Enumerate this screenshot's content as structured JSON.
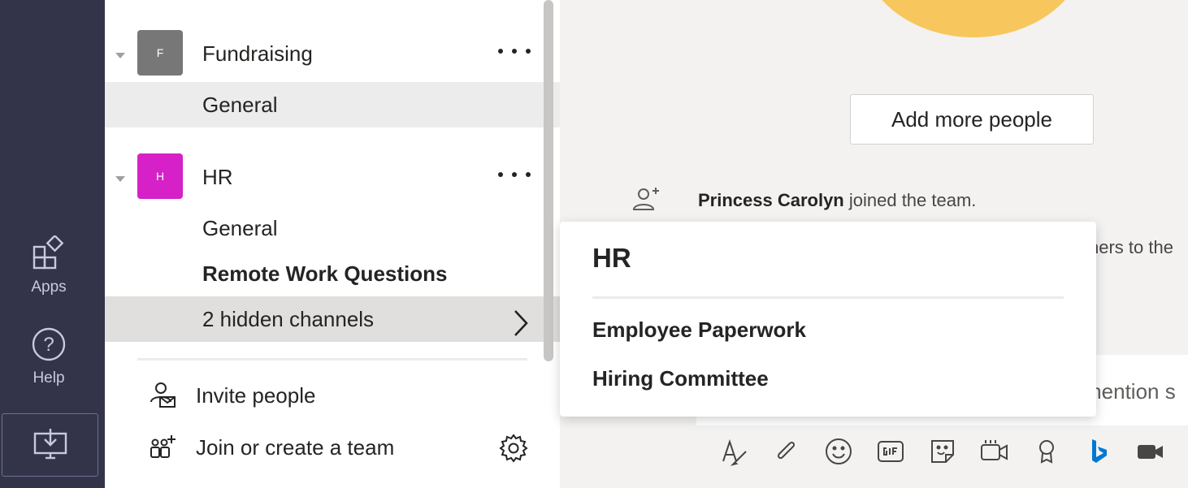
{
  "rail": {
    "apps_label": "Apps",
    "help_label": "Help",
    "help_symbol": "?"
  },
  "teams": [
    {
      "initial": "F",
      "name": "Fundraising",
      "color": "#777777",
      "channels": [
        "General"
      ]
    },
    {
      "initial": "H",
      "name": "HR",
      "color": "#d621c8",
      "channels": [
        "General",
        "Remote Work Questions"
      ],
      "hidden_channels_label": "2 hidden channels"
    }
  ],
  "actions": {
    "invite": "Invite people",
    "join_create": "Join or create a team"
  },
  "chat": {
    "add_more_people": "Add more people",
    "join_user": "Princess Carolyn",
    "join_text": " joined the team.",
    "partial_text": "hers to the",
    "composer_partial": "mention s"
  },
  "popup": {
    "title": "HR",
    "items": [
      "Employee Paperwork",
      "Hiring Committee"
    ]
  },
  "colors": {
    "rail_bg": "#33344a",
    "accent_sun": "#f7c75d"
  }
}
